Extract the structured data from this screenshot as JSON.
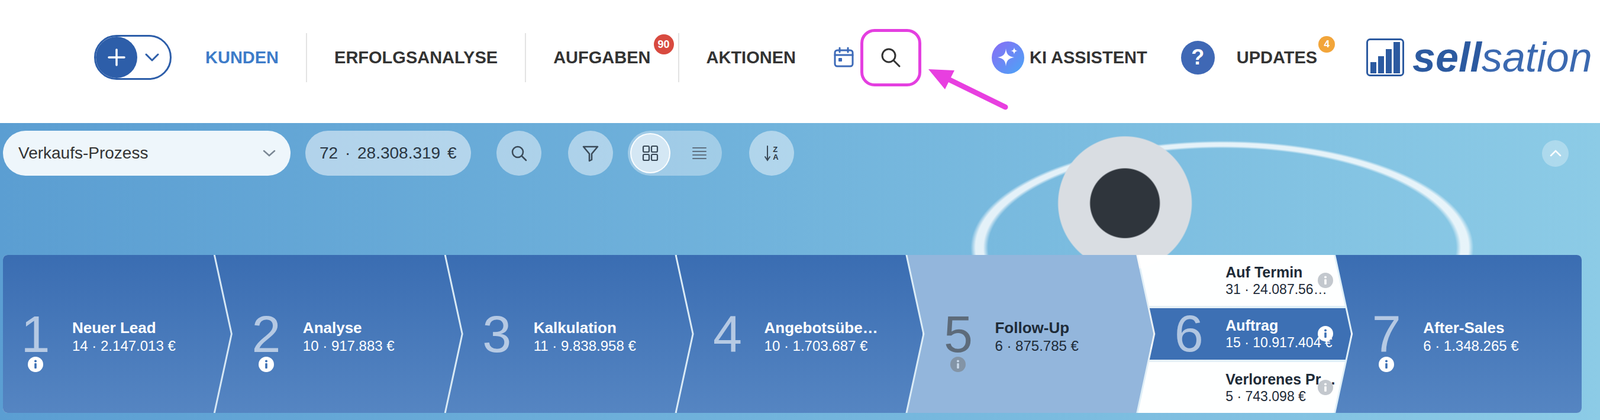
{
  "nav": {
    "items": [
      {
        "label": "KUNDEN",
        "selected": true
      },
      {
        "label": "ERFOLGSANALYSE",
        "selected": false
      },
      {
        "label": "AUFGABEN",
        "selected": false,
        "badge": {
          "text": "90",
          "color": "#d84a3f"
        }
      },
      {
        "label": "AKTIONEN",
        "selected": false
      }
    ],
    "tools": [
      {
        "kind": "calendar",
        "highlighted": false
      },
      {
        "kind": "search",
        "highlighted": true
      }
    ],
    "assistant": {
      "label": "KI ASSISTENT"
    },
    "help": {
      "icon": "?"
    },
    "updates": {
      "label": "UPDATES",
      "badge": {
        "text": "4",
        "color": "#f2a53a"
      }
    },
    "logo": {
      "parts": [
        {
          "text": "sell",
          "outline": false
        },
        {
          "text": "sation",
          "outline": true
        }
      ]
    }
  },
  "toolbar": {
    "process": "Verkaufs-Prozess",
    "summary": "72 · 28.308.319 €",
    "views": [
      {
        "kind": "grid",
        "selected": true
      },
      {
        "kind": "list",
        "selected": false
      }
    ],
    "sort": {
      "letters": [
        "Z",
        "A"
      ]
    }
  },
  "stages": [
    {
      "kind": "single",
      "number": "1",
      "name": "Neuer Lead",
      "summary": "14 · 2.147.013 €",
      "info": true,
      "selected": false
    },
    {
      "kind": "single",
      "number": "2",
      "name": "Analyse",
      "summary": "10 · 917.883 €",
      "info": true,
      "selected": false
    },
    {
      "kind": "single",
      "number": "3",
      "name": "Kalkulation",
      "summary": "11 · 9.838.958 €",
      "info": false,
      "selected": false
    },
    {
      "kind": "single",
      "number": "4",
      "name": "Angebotsübe…",
      "summary": "10 · 1.703.687 €",
      "info": false,
      "selected": false
    },
    {
      "kind": "single",
      "number": "5",
      "name": "Follow-Up",
      "summary": "6 · 875.785 €",
      "info": true,
      "selected": true
    },
    {
      "kind": "split",
      "number": "6",
      "selected": false,
      "substages": [
        {
          "name": "Auf Termin",
          "summary": "31 · 24.087.56…",
          "info": true,
          "selected": false
        },
        {
          "name": "Auftrag",
          "summary": "15 · 10.917.404 €",
          "info": true,
          "selected": true
        },
        {
          "name": "Verlorenes Pr…",
          "summary": "5 · 743.098 €",
          "info": true,
          "selected": false
        }
      ]
    },
    {
      "kind": "single",
      "number": "7",
      "name": "After-Sales",
      "summary": "6 · 1.348.265 €",
      "info": true,
      "selected": false
    }
  ]
}
